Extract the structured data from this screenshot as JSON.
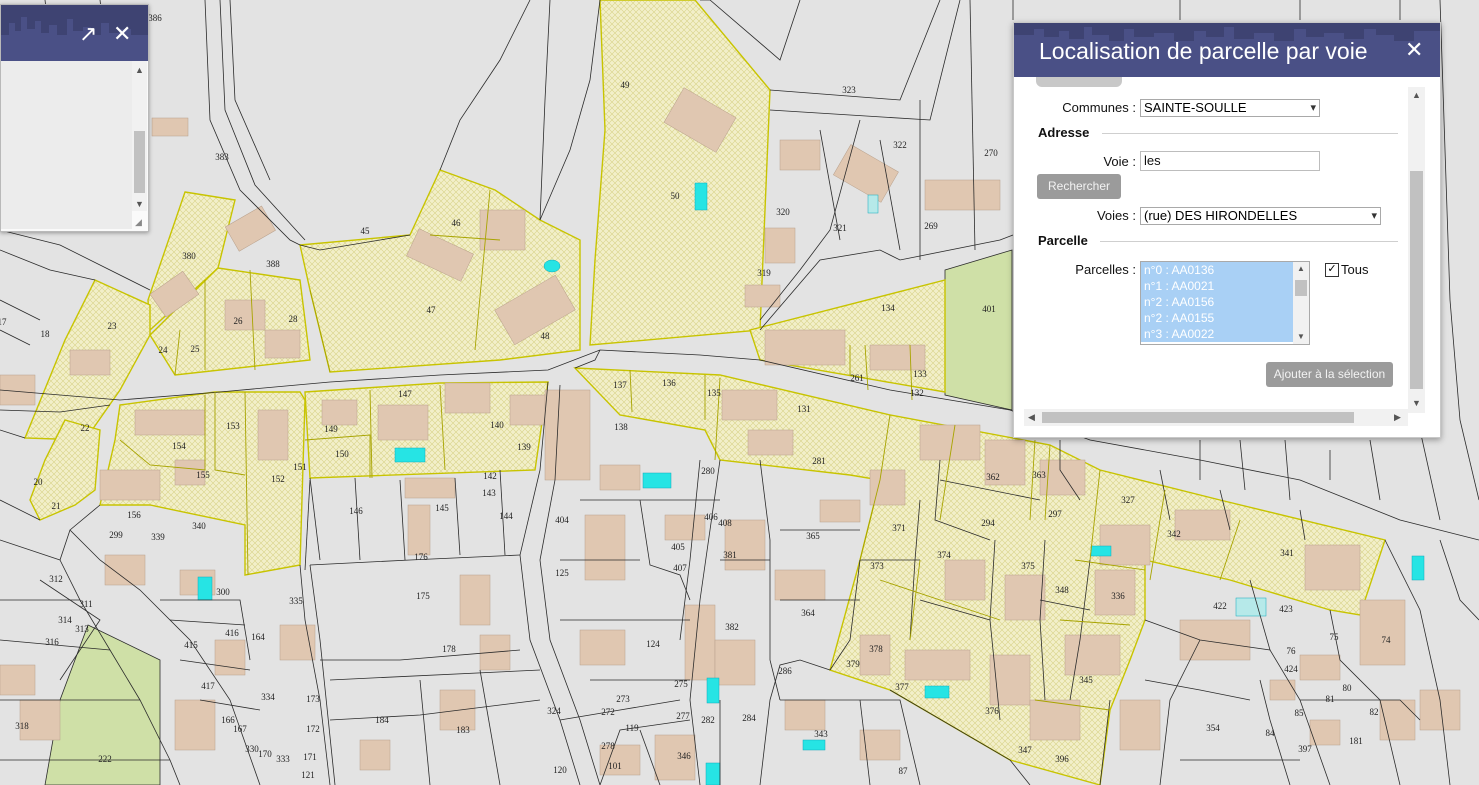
{
  "mini_window": {
    "expand_glyph": "↗",
    "close_glyph": "✕"
  },
  "panel": {
    "title": "Localisation de parcelle par voie",
    "close_glyph": "✕",
    "communes_label": "Communes :",
    "communes_value": "SAINTE-SOULLE",
    "adresse_section": "Adresse",
    "voie_label": "Voie :",
    "voie_value": "les",
    "rechercher_label": "Rechercher",
    "voies_label": "Voies :",
    "voies_value": "(rue) DES HIRONDELLES",
    "parcelle_section": "Parcelle",
    "parcelles_label": "Parcelles :",
    "parcelles": [
      "n°0 : AA0136",
      "n°1 : AA0021",
      "n°2 : AA0156",
      "n°2 : AA0155",
      "n°3 : AA0022"
    ],
    "tous_label": "Tous",
    "tous_checked": true,
    "ajouter_label": "Ajouter à la sélection"
  },
  "map": {
    "colors": {
      "background": "#e3e3e3",
      "building": "#e0c7b1",
      "parcel_line": "#2b2b2b",
      "highlight_line": "#c8c400",
      "green": "#cfe0a7",
      "pool": "#26e4e4"
    },
    "parcel_numbers": [
      "386",
      "383",
      "388",
      "380",
      "45",
      "46",
      "47",
      "49",
      "50",
      "48",
      "323",
      "322",
      "270",
      "320",
      "321",
      "269",
      "319",
      "17",
      "18",
      "23",
      "24",
      "25",
      "26",
      "28",
      "134",
      "401",
      "2",
      "137",
      "136",
      "135",
      "131",
      "261",
      "133",
      "132",
      "22",
      "153",
      "154",
      "147",
      "149",
      "150",
      "140",
      "139",
      "138",
      "281",
      "280",
      "20",
      "21",
      "155",
      "156",
      "152",
      "151",
      "142",
      "143",
      "144",
      "146",
      "145",
      "362",
      "363",
      "297",
      "327",
      "299",
      "339",
      "340",
      "404",
      "408",
      "405",
      "407",
      "406",
      "381",
      "365",
      "371",
      "294",
      "342",
      "341",
      "312",
      "300",
      "176",
      "125",
      "373",
      "374",
      "375",
      "336",
      "422",
      "423",
      "311",
      "314",
      "313",
      "316",
      "416",
      "415",
      "164",
      "335",
      "175",
      "382",
      "364",
      "348",
      "75",
      "74",
      "76",
      "178",
      "124",
      "378",
      "379",
      "424",
      "80",
      "417",
      "334",
      "173",
      "275",
      "286",
      "377",
      "345",
      "81",
      "82",
      "184",
      "172",
      "183",
      "324",
      "273",
      "272",
      "277",
      "282",
      "284",
      "343",
      "376",
      "354",
      "85",
      "84",
      "222",
      "318",
      "166",
      "167",
      "330",
      "170",
      "333",
      "171",
      "121",
      "278",
      "119",
      "346",
      "347",
      "396",
      "397",
      "181",
      "120",
      "101",
      "87"
    ]
  }
}
